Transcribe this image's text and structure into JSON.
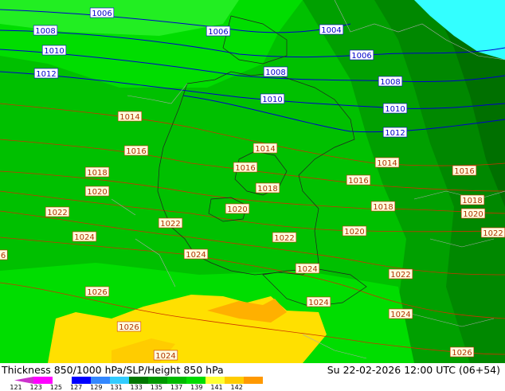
{
  "footer": {
    "title": "Thickness 850/1000 hPa/SLP/Height 850 hPa",
    "datetime": "Su 22-02-2026 12:00 UTC (06+54)"
  },
  "legend": {
    "ticks": [
      "121",
      "123",
      "125",
      "127",
      "129",
      "131",
      "133",
      "135",
      "137",
      "139",
      "141",
      "142"
    ],
    "colors": [
      "#cc33cc",
      "#ff00ff",
      "#ffffff",
      "#0000ff",
      "#3388ff",
      "#33ccff",
      "#007700",
      "#009900",
      "#00bb00",
      "#00dd00",
      "#ffff33",
      "#ffcc00",
      "#ff9900"
    ]
  },
  "map": {
    "colors": {
      "dark_green": "#007000",
      "mid_green": "#00a000",
      "green": "#00c000",
      "bright_green": "#00dd00",
      "yellow": "#ffe000",
      "orange": "#ffb000",
      "cyan": "#33ffff",
      "isobar_slp": "#0000cc",
      "isoline_height": "#cc3300",
      "border": "#222222"
    },
    "slp_labels": [
      "1006",
      "1008",
      "1006",
      "1004",
      "1010",
      "1006",
      "1012",
      "1008",
      "1008",
      "1010",
      "1010",
      "1012"
    ],
    "height_labels": [
      "1014",
      "1014",
      "1016",
      "1016",
      "1014",
      "1016",
      "1018",
      "1020",
      "1018",
      "1018",
      "1016",
      "1020",
      "1020",
      "1018",
      "1022",
      "1022",
      "1024",
      "1022",
      "1020",
      "1024",
      "1022",
      "1026",
      "1024",
      "1024",
      "1026",
      "1024",
      "1026",
      "6",
      "1022",
      "1024"
    ]
  }
}
